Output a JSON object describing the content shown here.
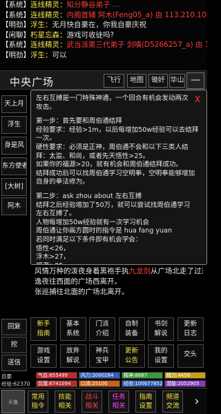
{
  "chat": [
    {
      "tag": "【系统】",
      "name": "连线精灵：",
      "text": "知分静谷弟子 …",
      "text_color": "c-red"
    },
    {
      "tag": "【系统】",
      "name": "连线精灵：",
      "text": "内阁首辅 阿木(Feng05_a) 由 113.210.108.1",
      "text_color": "c-red"
    },
    {
      "tag": "【明劲】",
      "name": "浮生：",
      "text": "无月快自豪在，你我自豪庆祝",
      "text_color": "c-white"
    },
    {
      "tag": "【闲聊】",
      "name": "朽星忘森：",
      "text": "游戏可收徒吗?",
      "text_color": "c-white"
    },
    {
      "tag": "【系统】",
      "name": "连线精灵：",
      "text": "武当派第三代弟子 剑嗔(D5266257_a) 由 117",
      "text_color": "c-red"
    },
    {
      "tag": "【明劲】",
      "name": "浮生：",
      "text": "可以",
      "text_color": "c-white"
    }
  ],
  "location": {
    "title": "中央广场",
    "nav": [
      "飞行",
      "地图",
      "锄奸",
      "华山"
    ],
    "menu_label": "—"
  },
  "side_buttons": [
    "天上月",
    "浮生",
    "身是风",
    "东方使者",
    "[大树]",
    "阿木"
  ],
  "popup": {
    "close": "X",
    "lines": [
      "左右互搏是一门特殊神通，一个回合有机会发动两次",
      "攻击。",
      "",
      "第一步：首先要和周伯通结拜",
      "经验要求：经验>1m，以后每增加50w经验可以去结拜",
      "一次。",
      "硬性要求：必须是正神，周伯通不会和以下三类人结",
      "拜：太监、和尚，或者先天悟性>25。",
      "如果你的福源>20，就有机会和周伯通结拜成功。",
      "结拜成功后可以找周伯通学习空明拳，空明拳能够增加",
      "自身的拳法修为。",
      "",
      "第二步：ask zhou about 左右互搏",
      "结拜之后经验增加了50万，就可以尝试找周伯通学习",
      "左右互搏了。",
      "人物每增加50w经验就有一次学习机会",
      "周伯通让你画方圆时的指令是 hua fang yuan",
      "若同时满足以下条件即有机会学会：",
      "悟性<26，",
      "浮木>27，",
      "福源>25。"
    ]
  },
  "room": {
    "line1_pre": "风情万种的泼夜身着黑袍手执",
    "line1_highlight": "九龙剑",
    "line1_post": "从广场北走了过来。",
    "line2": "逸夜往西面的广场西离开。",
    "line3": "张巡捕往北面的广场北离开。"
  },
  "bottom_left": [
    "回复",
    "挖",
    "送信"
  ],
  "grid": [
    {
      "label": "新手\n指南",
      "highlight": true
    },
    {
      "label": "基本\n系统",
      "highlight": false
    },
    {
      "label": "门派\n介绍",
      "highlight": false
    },
    {
      "label": "自制\n装备",
      "highlight": false
    },
    {
      "label": "书剑\n解说",
      "highlight": false
    },
    {
      "label": "更新\n日志",
      "highlight": false
    },
    {
      "label": "游戏\n设置",
      "highlight": false
    },
    {
      "label": "放弃\n解说",
      "highlight": false
    },
    {
      "label": "神兵\n宝甲",
      "highlight": false
    },
    {
      "label": "更新\n公告",
      "highlight": true
    },
    {
      "label": "我的\n设置",
      "highlight": false
    },
    {
      "label": "交头",
      "highlight": false
    }
  ],
  "stats": {
    "player_label": "自豪",
    "exp_label": "经验:62370",
    "bars": [
      {
        "text": "气血:655499",
        "color": "#c0282c",
        "fill": 1.0
      },
      {
        "text": "内力:2000284",
        "color": "#3060c0",
        "fill": 1.0
      },
      {
        "text": "精神:6687",
        "color": "#3a9a3a",
        "fill": 1.0
      },
      {
        "text": "精力:4456",
        "color": "#c8a020",
        "fill": 1.0
      },
      {
        "text": "饥饿:6741094",
        "color": "#c0282c",
        "fill": 1.0
      },
      {
        "text": "口渴:25100",
        "color": "#d06018",
        "fill": 1.0
      },
      {
        "text": "经验:100677852",
        "color": "#3060c0",
        "fill": 1.0
      },
      {
        "text": "潜能:2052905",
        "color": "#8a3ac0",
        "fill": 1.0
      }
    ]
  },
  "toolbar": {
    "avatar_label": "头像",
    "buttons": [
      {
        "label": "常用\n指令",
        "color": "#f2e34a"
      },
      {
        "label": "技能\n相关",
        "color": "#f2e34a"
      },
      {
        "label": "战斗\n相关",
        "color": "#ff4040"
      },
      {
        "label": "任务\n相关",
        "color": "#ff40ff"
      },
      {
        "label": "指南\n设置",
        "color": "#f2e34a"
      },
      {
        "label": "频道\n交流",
        "color": "#f2e34a"
      }
    ],
    "scroll_label": "›"
  }
}
